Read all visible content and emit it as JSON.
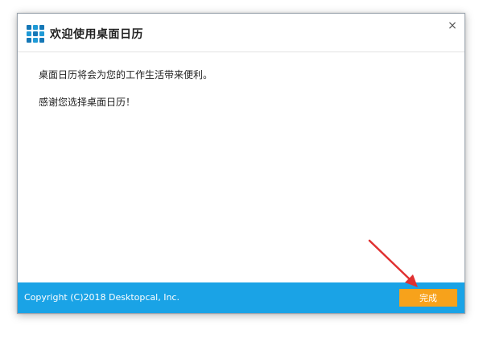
{
  "window": {
    "title": "欢迎使用桌面日历",
    "close_glyph": "×"
  },
  "content": {
    "line1": "桌面日历将会为您的工作生活带来便利。",
    "line2": "感谢您选择桌面日历！"
  },
  "footer": {
    "copyright": "Copyright (C)2018 Desktopcal, Inc.",
    "finish_label": "完成"
  },
  "colors": {
    "footer_bg": "#1aa3e6",
    "finish_button": "#f7a21b",
    "logo_blue": "#1f9ad6",
    "annotation_arrow": "#e03131"
  },
  "icons": {
    "app_logo": "grid-calendar-icon",
    "close": "close-icon",
    "annotation": "red-arrow-icon"
  }
}
